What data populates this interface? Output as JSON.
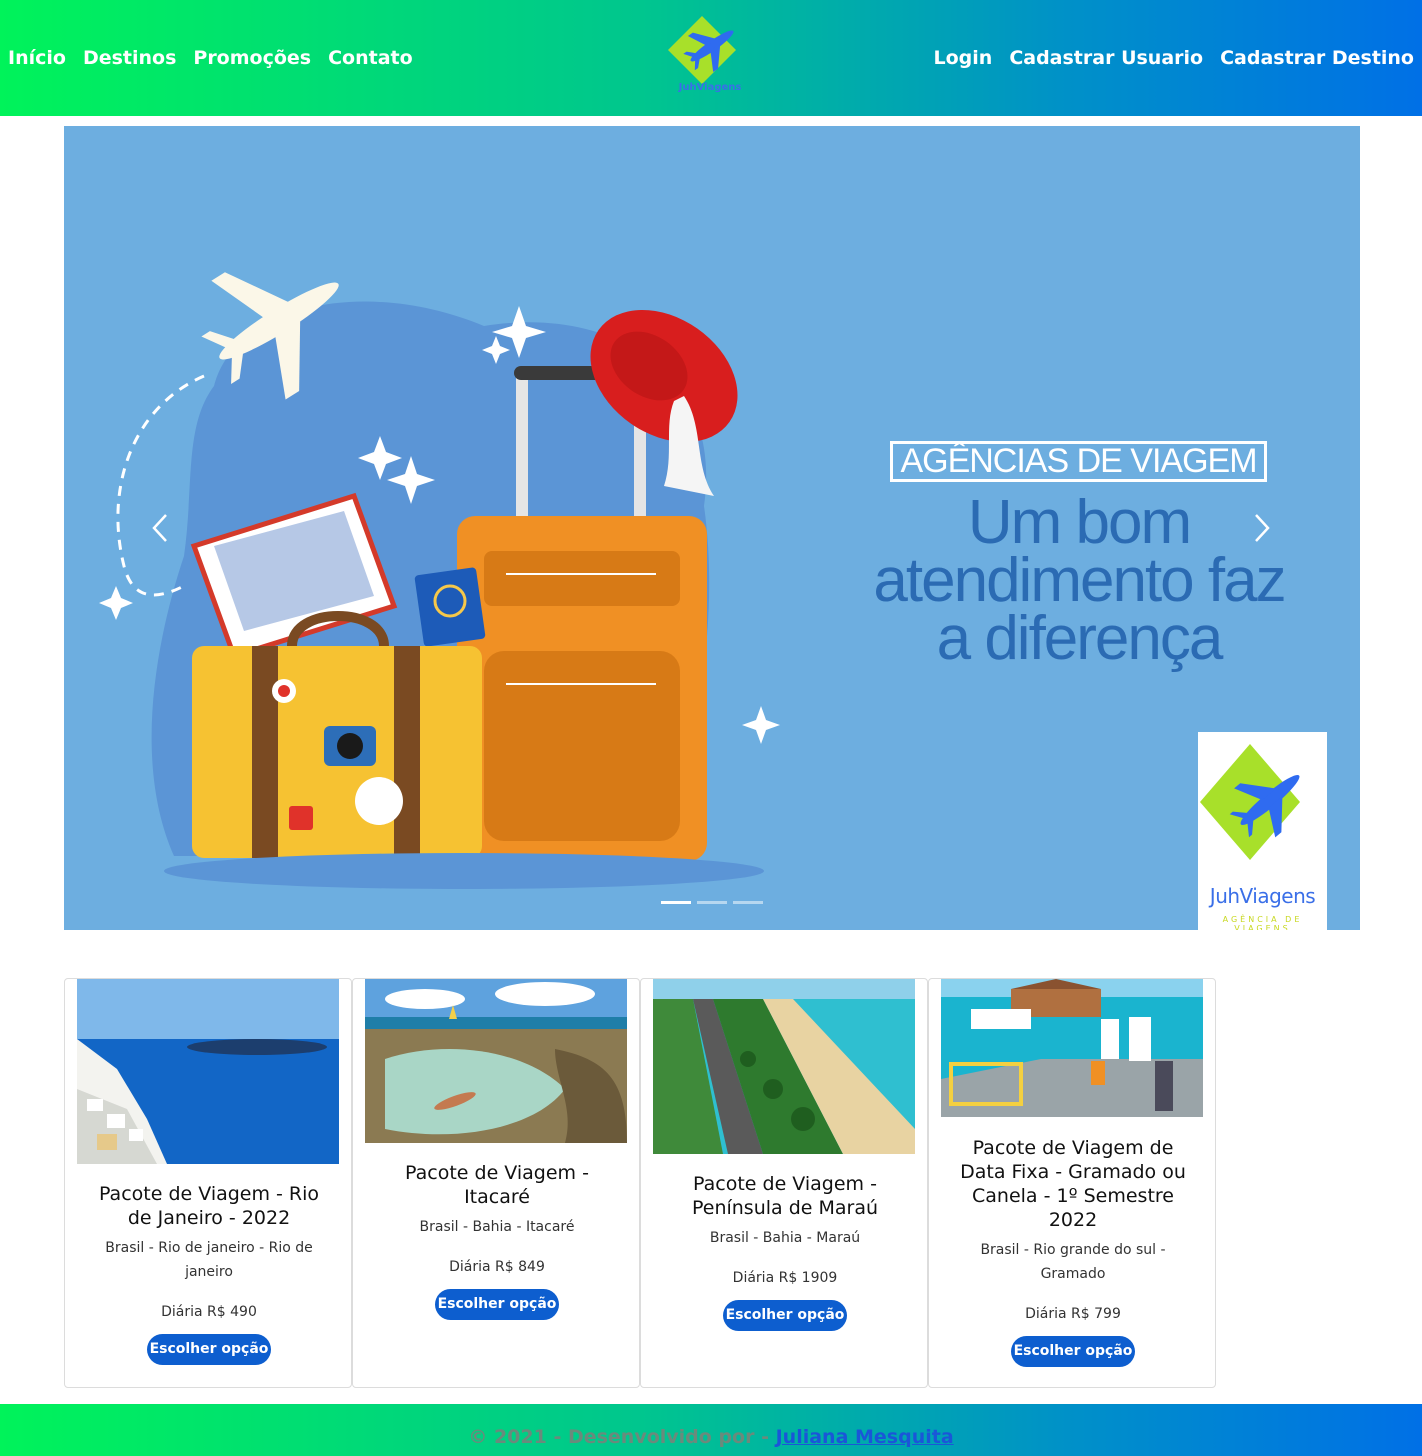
{
  "nav": {
    "left": [
      {
        "label": "Início"
      },
      {
        "label": "Destinos"
      },
      {
        "label": "Promoções"
      },
      {
        "label": "Contato"
      }
    ],
    "right": [
      {
        "label": "Login"
      },
      {
        "label": "Cadastrar Usuario"
      },
      {
        "label": "Cadastrar Destino"
      }
    ],
    "logo_text": "JuhViagens"
  },
  "carousel": {
    "badge": "AGÊNCIAS DE VIAGEM",
    "headline": "Um bom atendimento faz a diferença",
    "brand_name": "JuhViagens",
    "brand_sub": "AGÊNCIA DE VIAGENS",
    "slides": 3,
    "active_slide": 1,
    "prev_icon": "chevron-left-icon",
    "next_icon": "chevron-right-icon"
  },
  "cards": [
    {
      "title": "Pacote de Viagem - Rio de Janeiro - 2022",
      "location": "Brasil - Rio de janeiro - Rio de janeiro",
      "price": "Diária R$ 490",
      "button": "Escolher opção"
    },
    {
      "title": "Pacote de Viagem - Itacaré",
      "location": "Brasil - Bahia - Itacaré",
      "price": "Diária R$ 849",
      "button": "Escolher opção"
    },
    {
      "title": "Pacote de Viagem - Península de Maraú",
      "location": "Brasil - Bahia - Maraú",
      "price": "Diária R$ 1909",
      "button": "Escolher opção"
    },
    {
      "title": "Pacote de Viagem de Data Fixa - Gramado ou Canela - 1º Semestre 2022",
      "location": "Brasil - Rio grande do sul - Gramado",
      "price": "Diária R$ 799",
      "button": "Escolher opção"
    }
  ],
  "footer": {
    "text": "© 2021 - Desenvolvido por - ",
    "author": "Juliana Mesquita"
  },
  "colors": {
    "gradient_start": "#00f35a",
    "gradient_end": "#0070e6",
    "button": "#0d5ecf",
    "banner_bg": "#6daee0"
  }
}
